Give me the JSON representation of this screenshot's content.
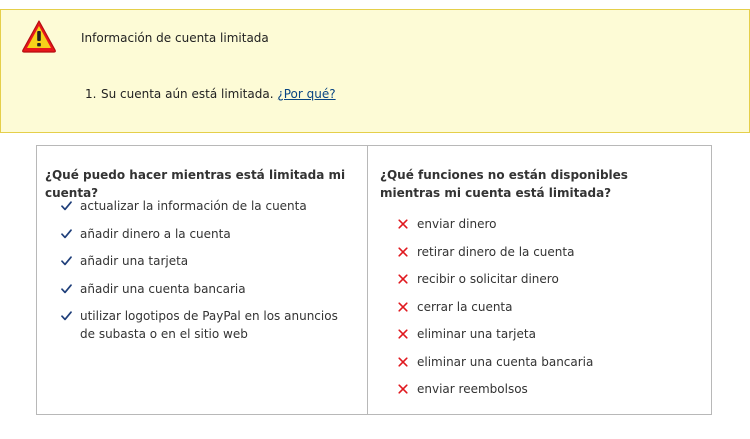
{
  "alert": {
    "icon": "warning-triangle-icon",
    "title": "Información de cuenta limitada",
    "items": [
      {
        "number": "1.",
        "text": "Su cuenta aún está limitada.",
        "link": "¿Por qué?"
      }
    ],
    "colors": {
      "background": "#fdfbd6",
      "border": "#e5cf4a",
      "icon_fill": "#e8161b",
      "link": "#084482"
    }
  },
  "can_do": {
    "title": "¿Qué puedo hacer mientras está limitada mi cuenta?",
    "icon": "check-icon",
    "items": [
      "actualizar la información de la cuenta",
      "añadir dinero a la cuenta",
      "añadir una tarjeta",
      "añadir una cuenta bancaria",
      "utilizar logotipos de PayPal en los anuncios de subasta o en el sitio web"
    ]
  },
  "cannot_do": {
    "title": "¿Qué funciones no están disponibles mientras mi cuenta está limitada?",
    "icon": "cross-icon",
    "items": [
      "enviar dinero",
      "retirar dinero de la cuenta",
      "recibir o solicitar dinero",
      "cerrar la cuenta",
      "eliminar una tarjeta",
      "eliminar una cuenta bancaria",
      "enviar reembolsos"
    ]
  }
}
